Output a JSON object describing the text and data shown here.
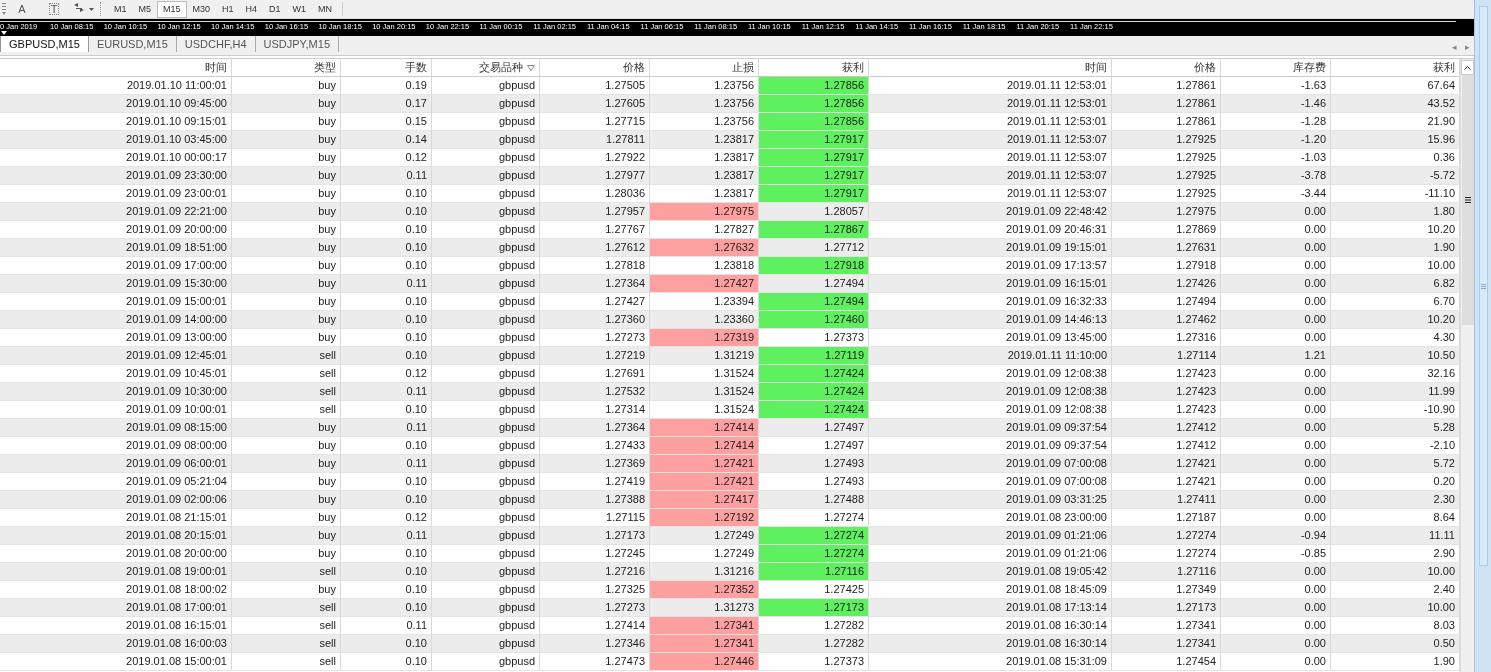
{
  "toolbar": {
    "tools": [
      {
        "kind": "text",
        "label": "A"
      },
      {
        "kind": "label",
        "label": "T"
      },
      {
        "kind": "arrows"
      }
    ],
    "timeframes": [
      {
        "label": "M1",
        "selected": false
      },
      {
        "label": "M5",
        "selected": false
      },
      {
        "label": "M15",
        "selected": true
      },
      {
        "label": "M30",
        "selected": false
      },
      {
        "label": "H1",
        "selected": false
      },
      {
        "label": "H4",
        "selected": false
      },
      {
        "label": "D1",
        "selected": false
      },
      {
        "label": "W1",
        "selected": false
      },
      {
        "label": "MN",
        "selected": false
      }
    ]
  },
  "timeline": [
    "0 Jan 2019",
    "10 Jan 08:15",
    "10 Jan 10:15",
    "10 Jan 12:15",
    "10 Jan 14:15",
    "10 Jan 16:15",
    "10 Jan 18:15",
    "10 Jan 20:15",
    "10 Jan 22:15",
    "11 Jan 00:15",
    "11 Jan 02:15",
    "11 Jan 04:15",
    "11 Jan 06:15",
    "11 Jan 08:15",
    "11 Jan 10:15",
    "11 Jan 12:15",
    "11 Jan 14:15",
    "11 Jan 16:15",
    "11 Jan 18:15",
    "11 Jan 20:15",
    "11 Jan 22:15"
  ],
  "tabs": [
    {
      "label": "GBPUSD,M15",
      "selected": true
    },
    {
      "label": "EURUSD,M15",
      "selected": false
    },
    {
      "label": "USDCHF,H4",
      "selected": false
    },
    {
      "label": "USDJPY,M15",
      "selected": false
    }
  ],
  "tab_scroll": [
    "◂",
    "▸"
  ],
  "table": {
    "columns": [
      "时间",
      "类型",
      "手数",
      "交易品种",
      "价格",
      "止损",
      "获利",
      "时间",
      "价格",
      "库存费",
      "获利"
    ],
    "rows": [
      {
        "cells": [
          "2019.01.10 11:00:01",
          "buy",
          "0.19",
          "gbpusd",
          "1.27505",
          "1.23756",
          "1.27856",
          "2019.01.11 12:53:01",
          "1.27861",
          "-1.63",
          "67.64"
        ],
        "sl_hit": false,
        "tp_hit": true
      },
      {
        "cells": [
          "2019.01.10 09:45:00",
          "buy",
          "0.17",
          "gbpusd",
          "1.27605",
          "1.23756",
          "1.27856",
          "2019.01.11 12:53:01",
          "1.27861",
          "-1.46",
          "43.52"
        ],
        "sl_hit": false,
        "tp_hit": true
      },
      {
        "cells": [
          "2019.01.10 09:15:01",
          "buy",
          "0.15",
          "gbpusd",
          "1.27715",
          "1.23756",
          "1.27856",
          "2019.01.11 12:53:01",
          "1.27861",
          "-1.28",
          "21.90"
        ],
        "sl_hit": false,
        "tp_hit": true
      },
      {
        "cells": [
          "2019.01.10 03:45:00",
          "buy",
          "0.14",
          "gbpusd",
          "1.27811",
          "1.23817",
          "1.27917",
          "2019.01.11 12:53:07",
          "1.27925",
          "-1.20",
          "15.96"
        ],
        "sl_hit": false,
        "tp_hit": true
      },
      {
        "cells": [
          "2019.01.10 00:00:17",
          "buy",
          "0.12",
          "gbpusd",
          "1.27922",
          "1.23817",
          "1.27917",
          "2019.01.11 12:53:07",
          "1.27925",
          "-1.03",
          "0.36"
        ],
        "sl_hit": false,
        "tp_hit": true
      },
      {
        "cells": [
          "2019.01.09 23:30:00",
          "buy",
          "0.11",
          "gbpusd",
          "1.27977",
          "1.23817",
          "1.27917",
          "2019.01.11 12:53:07",
          "1.27925",
          "-3.78",
          "-5.72"
        ],
        "sl_hit": false,
        "tp_hit": true
      },
      {
        "cells": [
          "2019.01.09 23:00:01",
          "buy",
          "0.10",
          "gbpusd",
          "1.28036",
          "1.23817",
          "1.27917",
          "2019.01.11 12:53:07",
          "1.27925",
          "-3.44",
          "-11.10"
        ],
        "sl_hit": false,
        "tp_hit": true
      },
      {
        "cells": [
          "2019.01.09 22:21:00",
          "buy",
          "0.10",
          "gbpusd",
          "1.27957",
          "1.27975",
          "1.28057",
          "2019.01.09 22:48:42",
          "1.27975",
          "0.00",
          "1.80"
        ],
        "sl_hit": true,
        "tp_hit": false
      },
      {
        "cells": [
          "2019.01.09 20:00:00",
          "buy",
          "0.10",
          "gbpusd",
          "1.27767",
          "1.27827",
          "1.27867",
          "2019.01.09 20:46:31",
          "1.27869",
          "0.00",
          "10.20"
        ],
        "sl_hit": false,
        "tp_hit": true
      },
      {
        "cells": [
          "2019.01.09 18:51:00",
          "buy",
          "0.10",
          "gbpusd",
          "1.27612",
          "1.27632",
          "1.27712",
          "2019.01.09 19:15:01",
          "1.27631",
          "0.00",
          "1.90"
        ],
        "sl_hit": true,
        "tp_hit": false
      },
      {
        "cells": [
          "2019.01.09 17:00:00",
          "buy",
          "0.10",
          "gbpusd",
          "1.27818",
          "1.23818",
          "1.27918",
          "2019.01.09 17:13:57",
          "1.27918",
          "0.00",
          "10.00"
        ],
        "sl_hit": false,
        "tp_hit": true
      },
      {
        "cells": [
          "2019.01.09 15:30:00",
          "buy",
          "0.11",
          "gbpusd",
          "1.27364",
          "1.27427",
          "1.27494",
          "2019.01.09 16:15:01",
          "1.27426",
          "0.00",
          "6.82"
        ],
        "sl_hit": true,
        "tp_hit": false
      },
      {
        "cells": [
          "2019.01.09 15:00:01",
          "buy",
          "0.10",
          "gbpusd",
          "1.27427",
          "1.23394",
          "1.27494",
          "2019.01.09 16:32:33",
          "1.27494",
          "0.00",
          "6.70"
        ],
        "sl_hit": false,
        "tp_hit": true
      },
      {
        "cells": [
          "2019.01.09 14:00:00",
          "buy",
          "0.10",
          "gbpusd",
          "1.27360",
          "1.23360",
          "1.27460",
          "2019.01.09 14:46:13",
          "1.27462",
          "0.00",
          "10.20"
        ],
        "sl_hit": false,
        "tp_hit": true
      },
      {
        "cells": [
          "2019.01.09 13:00:00",
          "buy",
          "0.10",
          "gbpusd",
          "1.27273",
          "1.27319",
          "1.27373",
          "2019.01.09 13:45:00",
          "1.27316",
          "0.00",
          "4.30"
        ],
        "sl_hit": true,
        "tp_hit": false
      },
      {
        "cells": [
          "2019.01.09 12:45:01",
          "sell",
          "0.10",
          "gbpusd",
          "1.27219",
          "1.31219",
          "1.27119",
          "2019.01.11 11:10:00",
          "1.27114",
          "1.21",
          "10.50"
        ],
        "sl_hit": false,
        "tp_hit": true
      },
      {
        "cells": [
          "2019.01.09 10:45:01",
          "sell",
          "0.12",
          "gbpusd",
          "1.27691",
          "1.31524",
          "1.27424",
          "2019.01.09 12:08:38",
          "1.27423",
          "0.00",
          "32.16"
        ],
        "sl_hit": false,
        "tp_hit": true
      },
      {
        "cells": [
          "2019.01.09 10:30:00",
          "sell",
          "0.11",
          "gbpusd",
          "1.27532",
          "1.31524",
          "1.27424",
          "2019.01.09 12:08:38",
          "1.27423",
          "0.00",
          "11.99"
        ],
        "sl_hit": false,
        "tp_hit": true
      },
      {
        "cells": [
          "2019.01.09 10:00:01",
          "sell",
          "0.10",
          "gbpusd",
          "1.27314",
          "1.31524",
          "1.27424",
          "2019.01.09 12:08:38",
          "1.27423",
          "0.00",
          "-10.90"
        ],
        "sl_hit": false,
        "tp_hit": true
      },
      {
        "cells": [
          "2019.01.09 08:15:00",
          "buy",
          "0.11",
          "gbpusd",
          "1.27364",
          "1.27414",
          "1.27497",
          "2019.01.09 09:37:54",
          "1.27412",
          "0.00",
          "5.28"
        ],
        "sl_hit": true,
        "tp_hit": false
      },
      {
        "cells": [
          "2019.01.09 08:00:00",
          "buy",
          "0.10",
          "gbpusd",
          "1.27433",
          "1.27414",
          "1.27497",
          "2019.01.09 09:37:54",
          "1.27412",
          "0.00",
          "-2.10"
        ],
        "sl_hit": true,
        "tp_hit": false
      },
      {
        "cells": [
          "2019.01.09 06:00:01",
          "buy",
          "0.11",
          "gbpusd",
          "1.27369",
          "1.27421",
          "1.27493",
          "2019.01.09 07:00:08",
          "1.27421",
          "0.00",
          "5.72"
        ],
        "sl_hit": true,
        "tp_hit": false
      },
      {
        "cells": [
          "2019.01.09 05:21:04",
          "buy",
          "0.10",
          "gbpusd",
          "1.27419",
          "1.27421",
          "1.27493",
          "2019.01.09 07:00:08",
          "1.27421",
          "0.00",
          "0.20"
        ],
        "sl_hit": true,
        "tp_hit": false
      },
      {
        "cells": [
          "2019.01.09 02:00:06",
          "buy",
          "0.10",
          "gbpusd",
          "1.27388",
          "1.27417",
          "1.27488",
          "2019.01.09 03:31:25",
          "1.27411",
          "0.00",
          "2.30"
        ],
        "sl_hit": true,
        "tp_hit": false
      },
      {
        "cells": [
          "2019.01.08 21:15:01",
          "buy",
          "0.12",
          "gbpusd",
          "1.27115",
          "1.27192",
          "1.27274",
          "2019.01.08 23:00:00",
          "1.27187",
          "0.00",
          "8.64"
        ],
        "sl_hit": true,
        "tp_hit": false
      },
      {
        "cells": [
          "2019.01.08 20:15:01",
          "buy",
          "0.11",
          "gbpusd",
          "1.27173",
          "1.27249",
          "1.27274",
          "2019.01.09 01:21:06",
          "1.27274",
          "-0.94",
          "11.11"
        ],
        "sl_hit": false,
        "tp_hit": true
      },
      {
        "cells": [
          "2019.01.08 20:00:00",
          "buy",
          "0.10",
          "gbpusd",
          "1.27245",
          "1.27249",
          "1.27274",
          "2019.01.09 01:21:06",
          "1.27274",
          "-0.85",
          "2.90"
        ],
        "sl_hit": false,
        "tp_hit": true
      },
      {
        "cells": [
          "2019.01.08 19:00:01",
          "sell",
          "0.10",
          "gbpusd",
          "1.27216",
          "1.31216",
          "1.27116",
          "2019.01.08 19:05:42",
          "1.27116",
          "0.00",
          "10.00"
        ],
        "sl_hit": false,
        "tp_hit": true
      },
      {
        "cells": [
          "2019.01.08 18:00:02",
          "buy",
          "0.10",
          "gbpusd",
          "1.27325",
          "1.27352",
          "1.27425",
          "2019.01.08 18:45:09",
          "1.27349",
          "0.00",
          "2.40"
        ],
        "sl_hit": true,
        "tp_hit": false
      },
      {
        "cells": [
          "2019.01.08 17:00:01",
          "sell",
          "0.10",
          "gbpusd",
          "1.27273",
          "1.31273",
          "1.27173",
          "2019.01.08 17:13:14",
          "1.27173",
          "0.00",
          "10.00"
        ],
        "sl_hit": false,
        "tp_hit": true
      },
      {
        "cells": [
          "2019.01.08 16:15:01",
          "sell",
          "0.11",
          "gbpusd",
          "1.27414",
          "1.27341",
          "1.27282",
          "2019.01.08 16:30:14",
          "1.27341",
          "0.00",
          "8.03"
        ],
        "sl_hit": true,
        "tp_hit": false
      },
      {
        "cells": [
          "2019.01.08 16:00:03",
          "sell",
          "0.10",
          "gbpusd",
          "1.27346",
          "1.27341",
          "1.27282",
          "2019.01.08 16:30:14",
          "1.27341",
          "0.00",
          "0.50"
        ],
        "sl_hit": true,
        "tp_hit": false
      },
      {
        "cells": [
          "2019.01.08 15:00:01",
          "sell",
          "0.10",
          "gbpusd",
          "1.27473",
          "1.27446",
          "1.27373",
          "2019.01.08 15:31:09",
          "1.27454",
          "0.00",
          "1.90"
        ],
        "sl_hit": true,
        "tp_hit": false
      }
    ]
  }
}
